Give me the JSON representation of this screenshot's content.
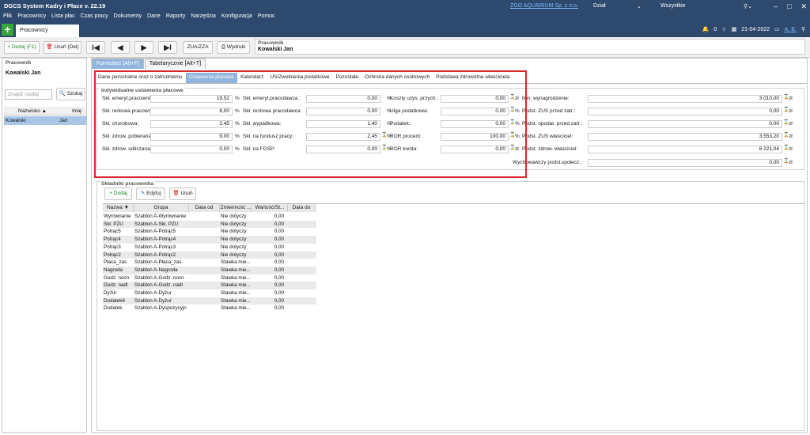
{
  "app": {
    "title": "DGCS System Kadry i Płace v. 22.19",
    "company_link": "ZGO AQUARIUM Sp. z o.o.",
    "dept": "Dział",
    "all": "Wszystkie",
    "window_controls": [
      "–",
      "□",
      "✕"
    ]
  },
  "menu": [
    "Plik",
    "Pracownicy",
    "Lista płac",
    "Czas pracy",
    "Dokumenty",
    "Dane",
    "Raporty",
    "Narzędzia",
    "Konfiguracja",
    "Pomoc"
  ],
  "tab": {
    "plus": "+",
    "label": "Pracownicy"
  },
  "status": {
    "notif_count": "0",
    "date": "21-04-2022",
    "user": "A. B."
  },
  "toolbar": {
    "add": "+ Dodaj (F1)",
    "del": "Usuń (Del)",
    "first": "I◀",
    "prev": "◀",
    "next": "▶",
    "last": "▶I",
    "zua": "ZUA/ZZA",
    "print": "Wydruki",
    "employee_label": "Pracownik",
    "employee_name": "Kowalski Jan"
  },
  "left": {
    "group_label": "Pracownik",
    "name": "Kowalski Jan",
    "search_placeholder": "Znajdź osobę",
    "search_btn": "Szukaj",
    "col_surname": "Nazwisko ▲",
    "col_name": "Imię",
    "row_surname": "Kowalski",
    "row_name": "Jan"
  },
  "formtabs": [
    "Formularz [Alt+F]",
    "Tabelarycznie [Alt+T]"
  ],
  "subtabs": [
    "Dane personalne oraz o zatrudnieniu",
    "Ustawienia płacowe",
    "Kalendarz",
    "US/Zwolnienia podatkowe",
    "Pozostałe",
    "Ochrona danych osobowych",
    "Podstawa zdrowotna właściciela"
  ],
  "indiv": {
    "title": "Indywidualne ustawienia płacowe",
    "col1": [
      {
        "label": "Skł. emeryt.pracownik:",
        "value": "19,52",
        "unit": "%"
      },
      {
        "label": "Skł. rentowa pracownik:",
        "value": "8,00",
        "unit": "%"
      },
      {
        "label": "Skł. chorobowa:",
        "value": "2,45",
        "unit": "%"
      },
      {
        "label": "Skł. zdrow. pobierana:",
        "value": "9,00",
        "unit": "%"
      },
      {
        "label": "Skł. zdrow. odliczana:",
        "value": "0,00",
        "unit": "%"
      }
    ],
    "col2": [
      {
        "label": "Skł. emeryt.pracodawca :",
        "value": "0,00",
        "unit": "%"
      },
      {
        "label": "Skł. rentowa pracodawca:",
        "value": "0,00",
        "unit": "%"
      },
      {
        "label": "Skł. wypadkowa:",
        "value": "1,40",
        "unit": "%"
      },
      {
        "label": "Skł. na fundusz pracy:",
        "value": "2,45",
        "unit": "%"
      },
      {
        "label": "Skł. na FGŚP:",
        "value": "0,00",
        "unit": "%"
      }
    ],
    "col3": [
      {
        "label": "Koszty uzys. przych.:",
        "value": "0,00",
        "unit": "zł"
      },
      {
        "label": "Ulga podatkowa:",
        "value": "0,00",
        "unit": "%"
      },
      {
        "label": "Podatek:",
        "value": "0,00",
        "unit": "%"
      },
      {
        "label": "ROR procent:",
        "value": "100,00",
        "unit": "%"
      },
      {
        "label": "ROR kwota:",
        "value": "0,00",
        "unit": "zł"
      }
    ],
    "col4": [
      {
        "label": "Min. wynagrodzenie:",
        "value": "3 010,00",
        "unit": "zł"
      },
      {
        "label": "Podst. ZUS przed zatr.:",
        "value": "0,00",
        "unit": "zł"
      },
      {
        "label": "Podst. opodat. przed zatr.:",
        "value": "0,00",
        "unit": "zł"
      },
      {
        "label": "Podst. ZUS właściciel:",
        "value": "3 553,20",
        "unit": "zł"
      },
      {
        "label": "Podst. zdrow. właściciel:",
        "value": "6 221,04",
        "unit": "zł"
      },
      {
        "label": "Wychowawczy podst.społecz.:",
        "value": "0,00",
        "unit": "zł"
      }
    ]
  },
  "skl": {
    "title": "Składniki pracownika",
    "add": "+ Dodaj",
    "edit": "Edytuj",
    "del": "Usuń",
    "headers": [
      "Nazwa ▼",
      "Grupa",
      "Data od",
      "Zmienność ...",
      "Wartość/St...",
      "Data do"
    ],
    "rows": [
      [
        "Wyrównanie",
        "Szablon A-Wyrównanie",
        "",
        "Nie dotyczy",
        "0,00",
        ""
      ],
      [
        "Skł. PZU",
        "Szablon A-Skł. PZU",
        "",
        "Nie dotyczy",
        "0,00",
        ""
      ],
      [
        "Potrąc5",
        "Szablon A-Potrąc5",
        "",
        "Nie dotyczy",
        "0,00",
        ""
      ],
      [
        "Potrąc4",
        "Szablon A-Potrąc4",
        "",
        "Nie dotyczy",
        "0,00",
        ""
      ],
      [
        "Potrąc3",
        "Szablon A-Potrąc3",
        "",
        "Nie dotyczy",
        "0,00",
        ""
      ],
      [
        "Potrąc2",
        "Szablon A-Potrąc2",
        "",
        "Nie dotyczy",
        "0,00",
        ""
      ],
      [
        "Płaca_zas",
        "Szablon A-Płaca_zas",
        "",
        "Stawka mie...",
        "0,00",
        ""
      ],
      [
        "Nagroda",
        "Szablon A-Nagroda",
        "",
        "Stawka mie...",
        "0,00",
        ""
      ],
      [
        "Godz. nocn",
        "Szablon A-Godz. nocn",
        "",
        "Stawka mie...",
        "0,00",
        ""
      ],
      [
        "Godz. nadl",
        "Szablon A-Godz. nadl",
        "",
        "Stawka mie...",
        "0,00",
        ""
      ],
      [
        "Dyżur",
        "Szablon A-Dyżur",
        "",
        "Stawka mie...",
        "0,00",
        ""
      ],
      [
        "Dodatek6",
        "Szablon A-Dyżur",
        "",
        "Stawka mie...",
        "0,00",
        ""
      ],
      [
        "Dodatek",
        "Szablon A-Dyspozycyjn",
        "",
        "Stawka mie...",
        "0,00",
        ""
      ]
    ]
  }
}
